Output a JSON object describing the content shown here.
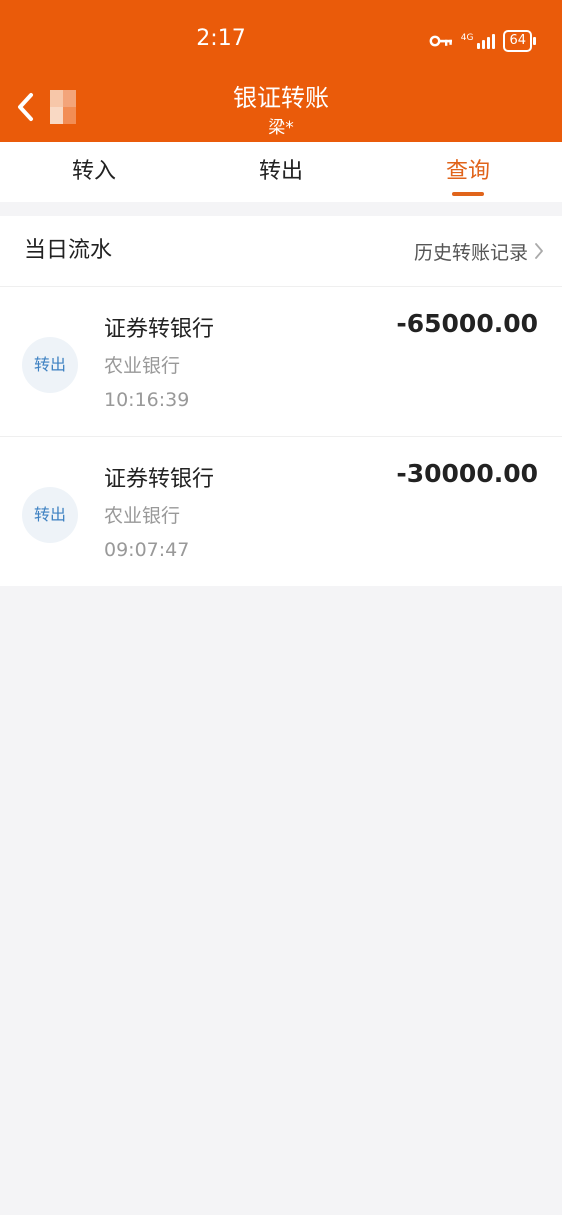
{
  "status_bar": {
    "time": "2:17",
    "network": "4G",
    "battery": "64"
  },
  "nav": {
    "title": "银证转账",
    "subtitle": "梁*"
  },
  "tabs": [
    {
      "label": "转入",
      "active": false
    },
    {
      "label": "转出",
      "active": false
    },
    {
      "label": "查询",
      "active": true
    }
  ],
  "section": {
    "title": "当日流水",
    "history_link": "历史转账记录"
  },
  "records": [
    {
      "badge": "转出",
      "title": "证券转银行",
      "bank": "农业银行",
      "time": "10:16:39",
      "amount": "-65000.00"
    },
    {
      "badge": "转出",
      "title": "证券转银行",
      "bank": "农业银行",
      "time": "09:07:47",
      "amount": "-30000.00"
    }
  ],
  "colors": {
    "header_bg": "#ea5b0a",
    "active_tab": "#e0641b",
    "badge_text": "#3f82c2",
    "badge_bg": "#eef3f8",
    "page_bg": "#f4f4f6"
  },
  "icons": {
    "back": "chevron-left-icon",
    "vpn_key": "key-icon",
    "signal": "signal-icon",
    "battery": "battery-icon",
    "history_arrow": "chevron-right-icon"
  }
}
